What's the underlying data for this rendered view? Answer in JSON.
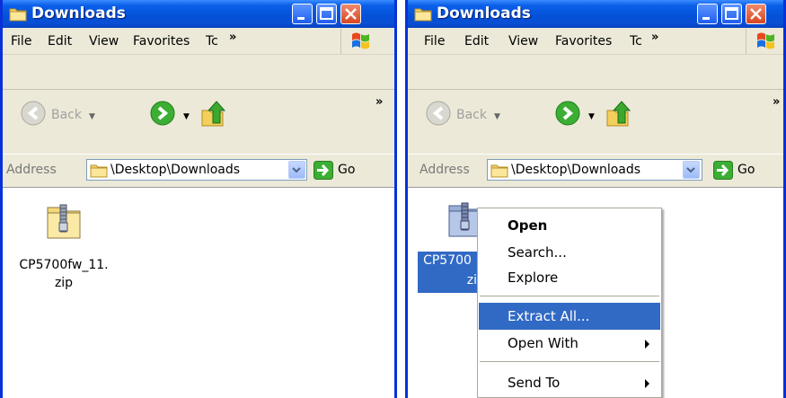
{
  "left_window": {
    "title": "Downloads",
    "menu": [
      "File",
      "Edit",
      "View",
      "Favorites",
      "Tc"
    ],
    "back_label": "Back",
    "address_label": "Address",
    "address_path": "\\Desktop\\Downloads",
    "go_label": "Go",
    "file": {
      "line1": "CP5700fw_11.",
      "line2": "zip",
      "icon": "zip-folder-icon"
    }
  },
  "right_window": {
    "title": "Downloads",
    "menu": [
      "File",
      "Edit",
      "View",
      "Favorites",
      "Tc"
    ],
    "back_label": "Back",
    "address_label": "Address",
    "address_path": "\\Desktop\\Downloads",
    "go_label": "Go",
    "file": {
      "line1": "CP5700",
      "line2": "zi",
      "icon": "zip-folder-icon"
    }
  },
  "context_menu": {
    "items": [
      {
        "label": "Open",
        "bold": true
      },
      {
        "label": "Search..."
      },
      {
        "label": "Explore"
      },
      {
        "label": "Extract All...",
        "highlighted": true
      },
      {
        "label": "Open With",
        "submenu": true
      },
      {
        "label": "Send To",
        "submenu": true
      }
    ]
  },
  "colors": {
    "title_bar": "#0a5fe8",
    "selection": "#316ac5",
    "chrome": "#ece9d8",
    "window_border": "#0831d9"
  }
}
